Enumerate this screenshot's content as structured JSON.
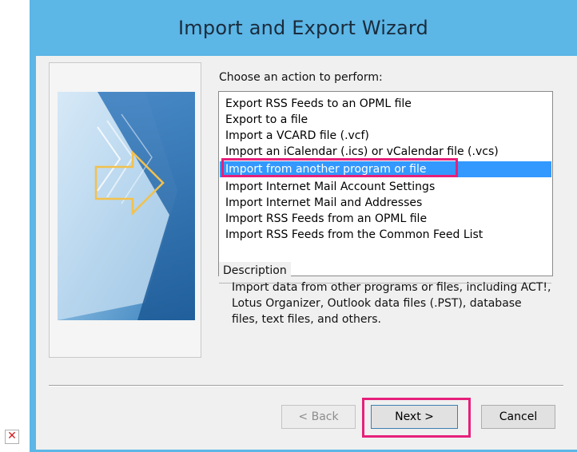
{
  "window": {
    "title": "Import and Export Wizard",
    "title_color": "#5cb6e6"
  },
  "prompt": "Choose an action to perform:",
  "list": {
    "items": [
      "Export RSS Feeds to an OPML file",
      "Export to a file",
      "Import a VCARD file (.vcf)",
      "Import an iCalendar (.ics) or vCalendar file (.vcs)",
      "Import from another program or file",
      "Import Internet Mail Account Settings",
      "Import Internet Mail and Addresses",
      "Import RSS Feeds from an OPML file",
      "Import RSS Feeds from the Common Feed List"
    ],
    "selected_index": 4,
    "selection_color": "#3399ff",
    "highlight_color": "#e6207a"
  },
  "description": {
    "legend": "Description",
    "text": "Import data from other programs or files, including ACT!, Lotus Organizer, Outlook data files (.PST), database files, text files, and others."
  },
  "buttons": {
    "back": "< Back",
    "next": "Next >",
    "cancel": "Cancel"
  },
  "broken_image_icon": "broken-image-icon"
}
